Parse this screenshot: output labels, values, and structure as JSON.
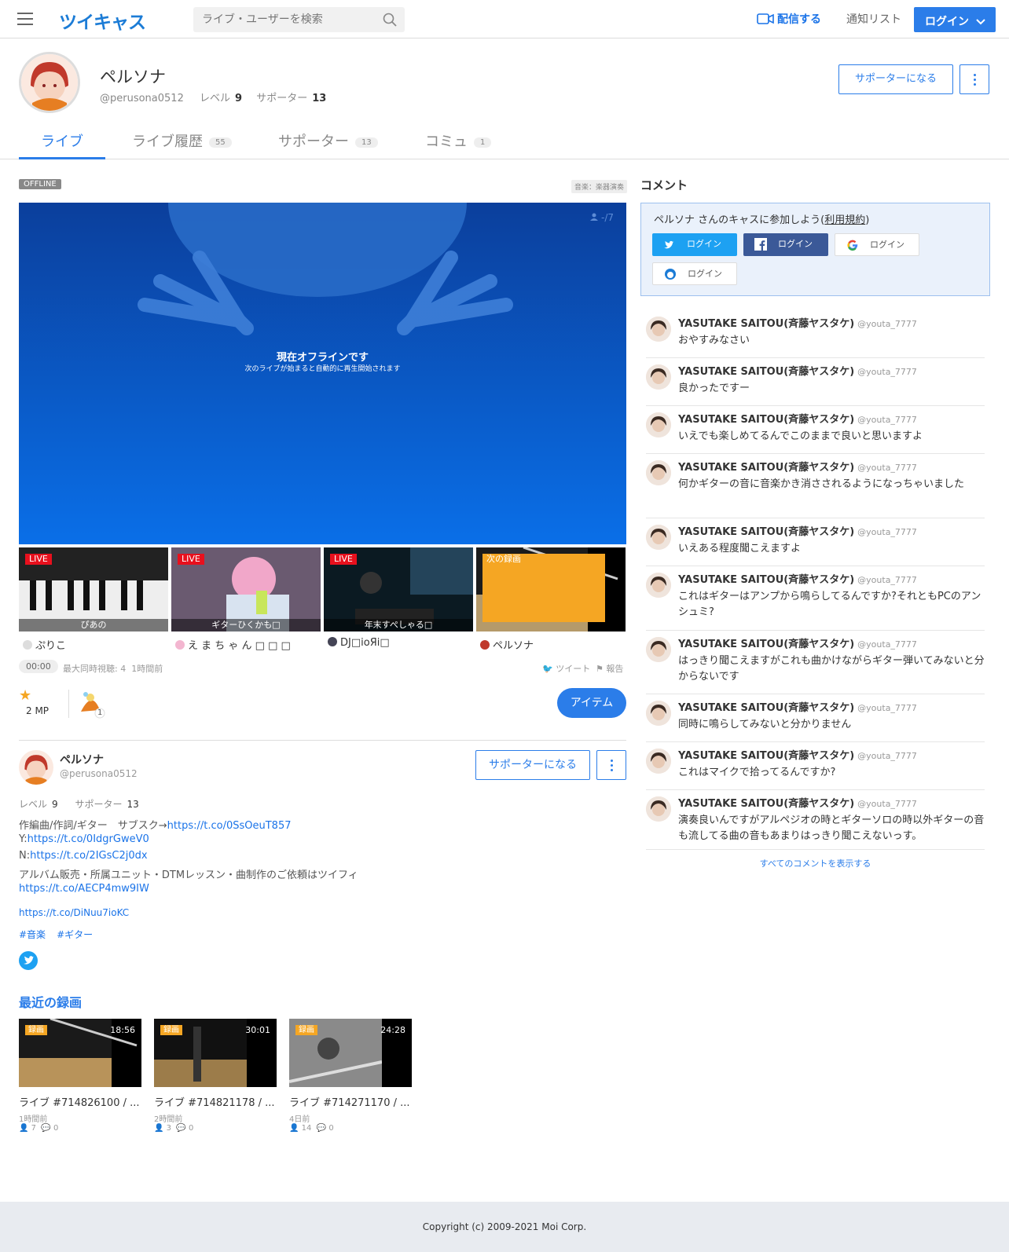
{
  "header": {
    "logo": "ツイキャス",
    "search_placeholder": "ライブ・ユーザーを検索",
    "broadcast": "配信する",
    "notify": "通知リスト",
    "login": "ログイン"
  },
  "profile": {
    "name": "ペルソナ",
    "id": "@perusona0512",
    "level_label": "レベル",
    "level": "9",
    "supporter_label": "サポーター",
    "supporters": "13",
    "supporter_button": "サポーターになる"
  },
  "tabs": [
    {
      "label": "ライブ",
      "count": ""
    },
    {
      "label": "ライブ履歴",
      "count": "55"
    },
    {
      "label": "サポーター",
      "count": "13"
    },
    {
      "label": "コミュ",
      "count": "1"
    }
  ],
  "player": {
    "status": "OFFLINE",
    "category": "音楽：楽器演奏",
    "viewers": "-/7",
    "offline_title": "現在オフラインです",
    "offline_sub": "次のライブが始まると自動的に再生開始されます"
  },
  "thumbs": [
    {
      "tag": "LIVE",
      "title": "ぴあの",
      "user": "ぷりこ"
    },
    {
      "tag": "LIVE",
      "title": "ギターひくかも□",
      "user": "え ま ち ゃ ん □ □ □"
    },
    {
      "tag": "LIVE",
      "title": "年末すぺしゃる□",
      "user": "DJ□ioЯi□"
    },
    {
      "tag": "次の録画",
      "title": "",
      "user": "ペルソナ"
    }
  ],
  "stats": {
    "time": "00:00",
    "max_view": "最大同時視聴: 4",
    "ago": "1時間前",
    "tweet": "ツイート",
    "report": "報告",
    "mp": "2 MP",
    "item_count": "1",
    "item_button": "アイテム"
  },
  "bio": {
    "line1_text": "作編曲/作詞/ギター　サブスク→",
    "line1_link": "https://t.co/0SsOeuT857",
    "line2_text": "Y:",
    "line2_link": "https://t.co/0IdgrGweV0",
    "line3_text": "N:",
    "line3_link": "https://t.co/2IGsC2j0dx",
    "line4_text": "アルバム販売・所属ユニット・DTMレッスン・曲制作のご依頼はツイフィ",
    "line5_link": "https://t.co/AECP4mw9IW",
    "line6_link": "https://t.co/DiNuu7ioKC",
    "hashtags": [
      "#音楽",
      "#ギター"
    ]
  },
  "recent": {
    "title": "最近の録画",
    "items": [
      {
        "tag": "録画",
        "duration": "18:56",
        "title": "ライブ #714826100 / ...",
        "ago": "1時間前",
        "views": "7",
        "comments": "0"
      },
      {
        "tag": "録画",
        "duration": "30:01",
        "title": "ライブ #714821178 / ...",
        "ago": "2時間前",
        "views": "3",
        "comments": "0"
      },
      {
        "tag": "録画",
        "duration": "24:28",
        "title": "ライブ #714271170 / ...",
        "ago": "4日前",
        "views": "14",
        "comments": "0"
      }
    ]
  },
  "comments_panel": {
    "title": "コメント",
    "join_text": "ペルソナ さんのキャスに参加しよう(",
    "terms": "利用規約",
    "join_close": ")",
    "login_label": "ログイン",
    "all": "すべてのコメントを表示する"
  },
  "comments": [
    {
      "name": "YASUTAKE SAITOU(斉藤ヤスタケ)",
      "id": "@youta_7777",
      "text": "おやすみなさい"
    },
    {
      "name": "YASUTAKE SAITOU(斉藤ヤスタケ)",
      "id": "@youta_7777",
      "text": "良かったですー"
    },
    {
      "name": "YASUTAKE SAITOU(斉藤ヤスタケ)",
      "id": "@youta_7777",
      "text": "いえでも楽しめてるんでこのままで良いと思いますよ"
    },
    {
      "name": "YASUTAKE SAITOU(斉藤ヤスタケ)",
      "id": "@youta_7777",
      "text": "何かギターの音に音楽かき消さされるようになっちゃいました"
    },
    {
      "name": "YASUTAKE SAITOU(斉藤ヤスタケ)",
      "id": "@youta_7777",
      "text": "いえある程度聞こえますよ"
    },
    {
      "name": "YASUTAKE SAITOU(斉藤ヤスタケ)",
      "id": "@youta_7777",
      "text": "これはギターはアンプから鳴らしてるんですか?それともPCのアンシュミ?"
    },
    {
      "name": "YASUTAKE SAITOU(斉藤ヤスタケ)",
      "id": "@youta_7777",
      "text": "はっきり聞こえますがこれも曲かけながらギター弾いてみないと分からないです"
    },
    {
      "name": "YASUTAKE SAITOU(斉藤ヤスタケ)",
      "id": "@youta_7777",
      "text": "同時に鳴らしてみないと分かりません"
    },
    {
      "name": "YASUTAKE SAITOU(斉藤ヤスタケ)",
      "id": "@youta_7777",
      "text": "これはマイクで拾ってるんですか?"
    },
    {
      "name": "YASUTAKE SAITOU(斉藤ヤスタケ)",
      "id": "@youta_7777",
      "text": "演奏良いんですがアルペジオの時とギターソロの時以外ギターの音も流してる曲の音もあまりはっきり聞こえないっす。"
    }
  ],
  "footer": "Copyright (c) 2009-2021 Moi Corp.",
  "colors": {
    "accent": "#2b7de9",
    "live": "#e8101d",
    "recording": "#f5a623"
  }
}
